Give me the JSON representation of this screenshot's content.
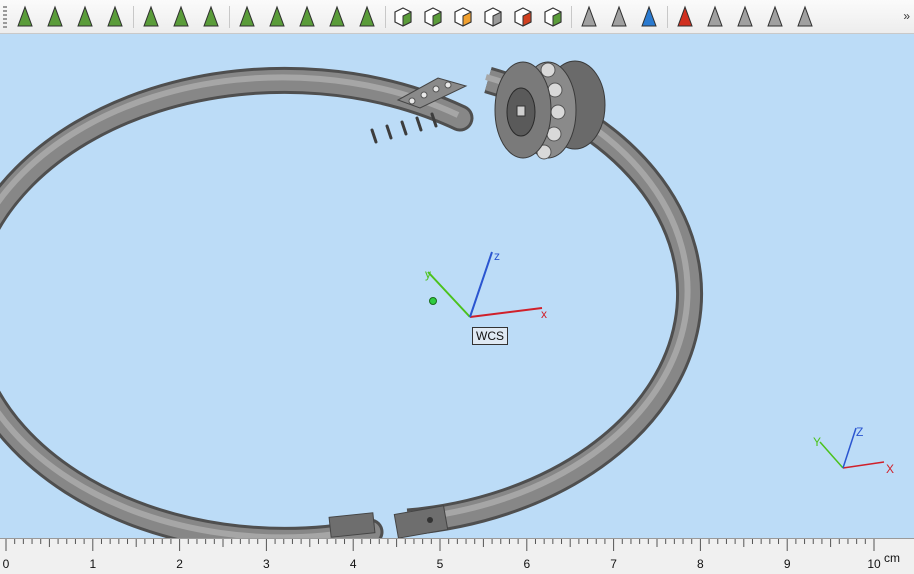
{
  "toolbar": {
    "buttons": [
      {
        "name": "select-arrow-icon",
        "color": "#5a9c3a"
      },
      {
        "name": "select-face-icon",
        "color": "#5a9c3a"
      },
      {
        "name": "select-curve-icon",
        "color": "#5a9c3a"
      },
      {
        "name": "select-circle-icon",
        "color": "#5a9c3a"
      },
      {
        "name": "select-rectangle-icon",
        "color": "#5a9c3a"
      },
      {
        "name": "select-nodes-icon",
        "color": "#5a9c3a"
      },
      {
        "name": "select-spline-icon",
        "color": "#5a9c3a"
      },
      {
        "name": "select-mesh-icon",
        "color": "#5a9c3a"
      },
      {
        "name": "select-joint-icon",
        "color": "#5a9c3a"
      },
      {
        "name": "select-fan-icon",
        "color": "#5a9c3a"
      },
      {
        "name": "select-wheel-icon",
        "color": "#5a9c3a"
      },
      {
        "name": "select-spokes-icon",
        "color": "#5a9c3a"
      },
      {
        "name": "cube-select-icon",
        "color": "#5a9c3a"
      },
      {
        "name": "cube-pick-icon",
        "color": "#5a9c3a"
      },
      {
        "name": "cube-orange-icon",
        "color": "#f0a030"
      },
      {
        "name": "cube-outline-icon",
        "color": "#9a9a9a"
      },
      {
        "name": "cube-red-icon",
        "color": "#d04020"
      },
      {
        "name": "cube-green-icon",
        "color": "#5a9c3a"
      },
      {
        "name": "arrow-gray-icon",
        "color": "#a0a0a0"
      },
      {
        "name": "arrow-multi-gray-icon",
        "color": "#a0a0a0"
      },
      {
        "name": "arrow-blue-icon",
        "color": "#2a7ad0"
      },
      {
        "name": "arrow-delete-icon",
        "color": "#d03020"
      },
      {
        "name": "arrow-ghost-icon",
        "color": "#a0a0a0"
      },
      {
        "name": "arrow-copy-icon",
        "color": "#a0a0a0"
      },
      {
        "name": "arrow-fill-icon",
        "color": "#a0a0a0"
      },
      {
        "name": "arrow-eye-icon",
        "color": "#a0a0a0"
      }
    ],
    "overflow": "»"
  },
  "viewport": {
    "background": "#bcdcf7",
    "wcs_label": "WCS",
    "axes": {
      "x": "x",
      "y": "y",
      "z": "z"
    },
    "mini_axes": {
      "x": "X",
      "y": "Y",
      "z": "Z"
    },
    "colors": {
      "x": "#d0202a",
      "y": "#4bc21c",
      "z": "#2a55d0",
      "part": "#7d7d7d"
    }
  },
  "ruler": {
    "labels": [
      "0",
      "1",
      "2",
      "3",
      "4",
      "5",
      "6",
      "7",
      "8",
      "9",
      "10"
    ],
    "unit": "cm"
  }
}
